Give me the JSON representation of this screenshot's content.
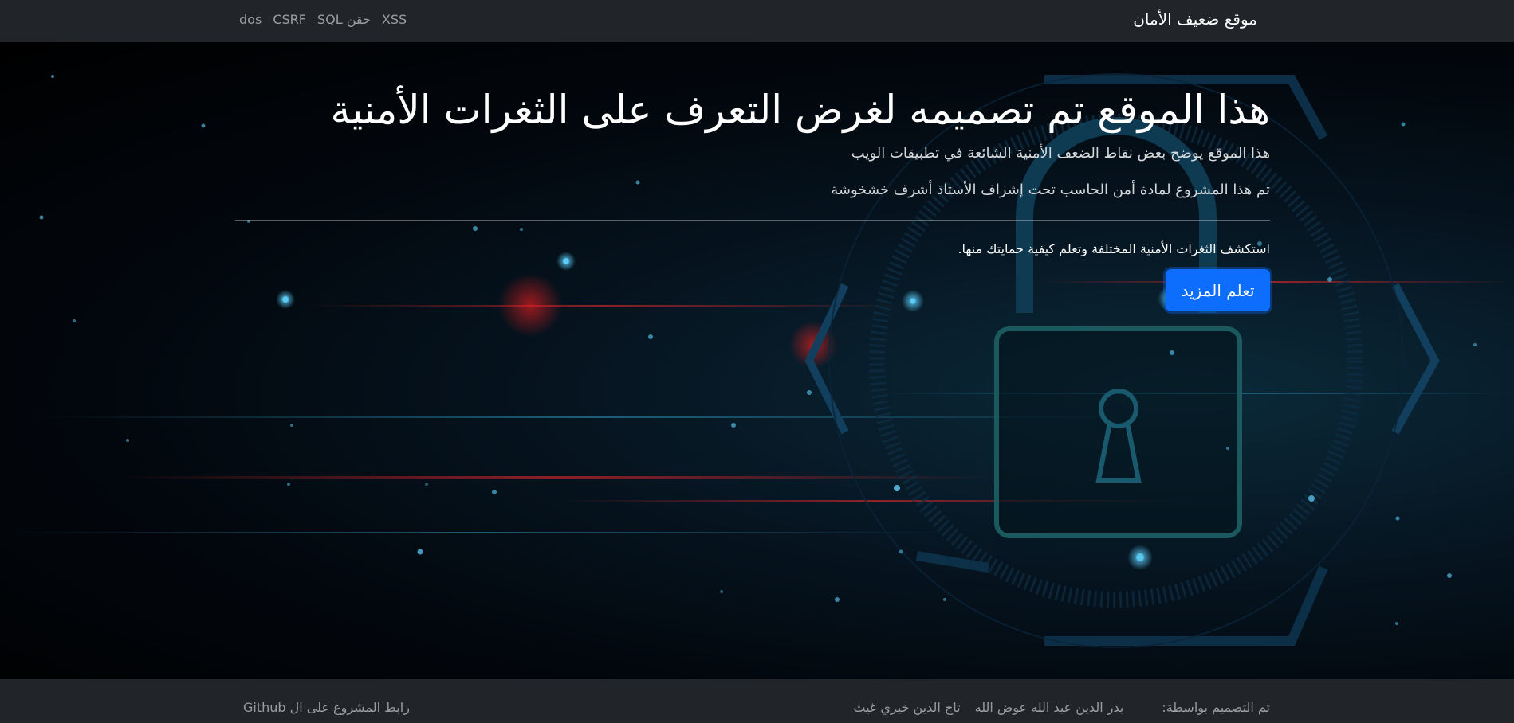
{
  "navbar": {
    "brand": "موقع ضعيف الأمان",
    "links": [
      "XSS",
      "حقن SQL",
      "CSRF",
      "dos"
    ]
  },
  "hero": {
    "title": "هذا الموقع تم تصميمه لغرض التعرف على الثغرات الأمنية",
    "lead1": "هذا الموقع يوضح بعض نقاط الضعف الأمنية الشائعة في تطبيقات الويب",
    "lead2": "تم هذا المشروع لمادة أمن الحاسب تحت إشراف الأستاذ أشرف خشخوشة",
    "explore": "استكشف الثغرات الأمنية المختلفة وتعلم كيفية حمايتك منها.",
    "button": "تعلم المزيد"
  },
  "footer": {
    "label": "تم التصميم بواسطة:",
    "designers": [
      "بدر الدين عبد الله عوض الله",
      "تاج الدين خيري غيث"
    ],
    "github": "رابط المشروع على ال Github"
  },
  "colors": {
    "navbar": "#212529",
    "primary": "#0d6efd",
    "hero_glow": "#0b2a3a"
  },
  "icons": [
    "padlock-icon",
    "chevron-left-icon",
    "chevron-right-icon"
  ]
}
